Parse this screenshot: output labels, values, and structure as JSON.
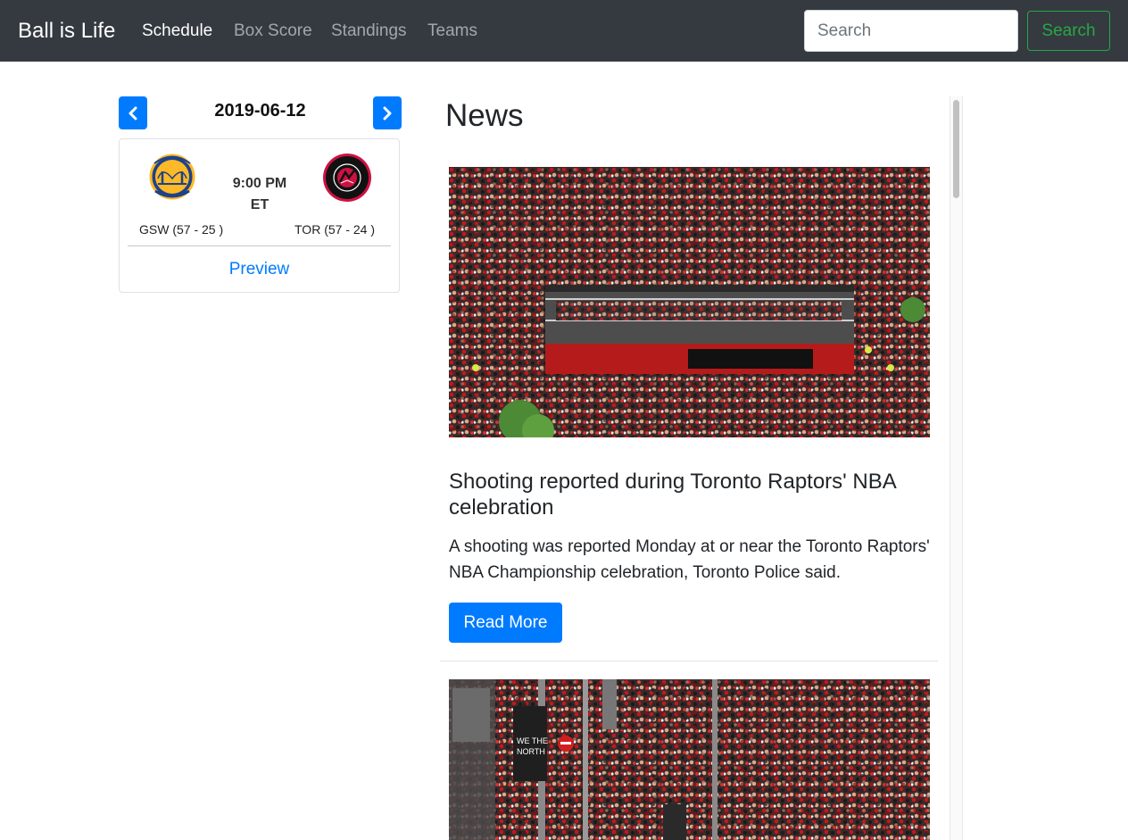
{
  "navbar": {
    "brand": "Ball is Life",
    "links": [
      {
        "label": "Schedule",
        "active": true
      },
      {
        "label": "Box Score",
        "active": false
      },
      {
        "label": "Standings",
        "active": false
      },
      {
        "label": "Teams",
        "active": false
      }
    ],
    "search_placeholder": "Search",
    "search_button": "Search"
  },
  "schedule": {
    "date": "2019-06-12",
    "prev_icon": "chevron-left-icon",
    "next_icon": "chevron-right-icon",
    "game": {
      "away_team": "GSW (57 - 25 )",
      "home_team": "TOR (57 - 24 )",
      "time": "9:00 PM",
      "timezone": "ET",
      "link_label": "Preview",
      "away_logo": "warriors-logo",
      "home_logo": "raptors-logo"
    }
  },
  "news": {
    "heading": "News",
    "articles": [
      {
        "title": "Shooting reported during Toronto Raptors' NBA celebration",
        "description": "A shooting was reported Monday at or near the Toronto Raptors' NBA Championship celebration, Toronto Police said.",
        "button_label": "Read More",
        "image": "parade-bus-crowd-photo"
      },
      {
        "image": "parade-street-crowd-photo",
        "sign_text": "WE THE NORTH"
      }
    ]
  },
  "colors": {
    "navbar_bg": "#343a40",
    "primary": "#007bff",
    "success": "#28a745"
  }
}
